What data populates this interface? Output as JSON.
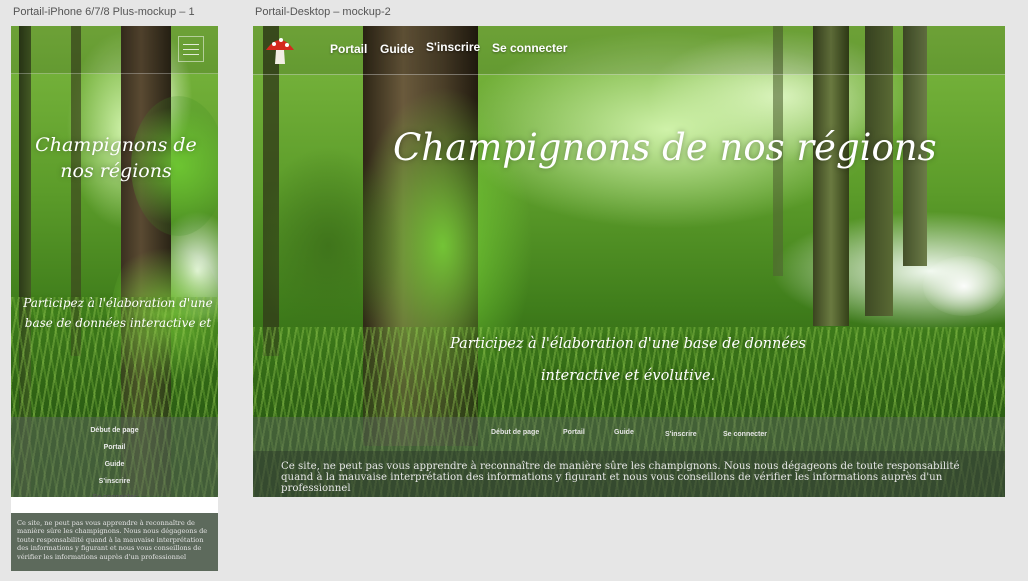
{
  "artboards": {
    "mobile_title": "Portail-iPhone 6/7/8 Plus-mockup – 1",
    "desktop_title": "Portail-Desktop – mockup-2"
  },
  "site": {
    "heading": "Champignons de nos régions",
    "tagline_desktop": "Participez à l'élaboration d'une base de données interactive et évolutive.",
    "tagline_mobile": "Participez à l'élaboration d'une base de données interactive et",
    "top_nav": [
      "Portail",
      "Guide",
      "S'inscrire",
      "Se connecter"
    ],
    "footer_nav": [
      "Début de page",
      "Portail",
      "Guide",
      "S'inscrire",
      "Se connecter"
    ],
    "disclaimer": "Ce site, ne peut pas vous apprendre à reconnaître de manière sûre les champignons. Nous nous dégageons de toute responsabilité quand à la mauvaise interprétation des informations y figurant et nous vous conseillons de vérifier les informations auprès d'un professionnel"
  }
}
